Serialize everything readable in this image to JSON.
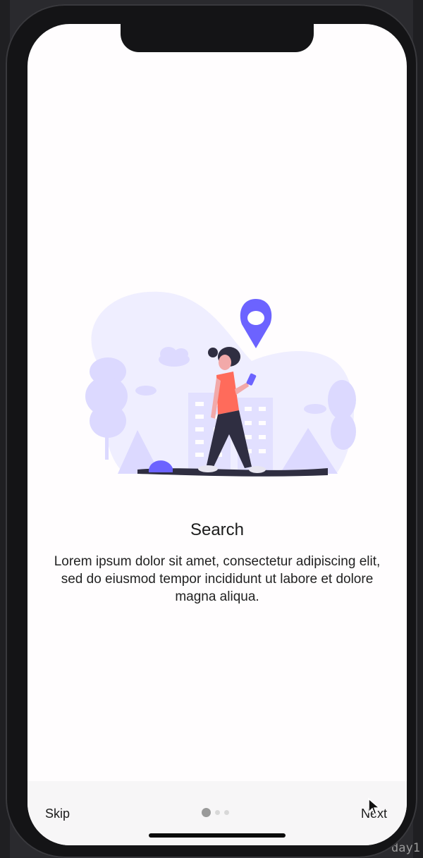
{
  "onboarding": {
    "title": "Search",
    "body": "Lorem ipsum dolor sit amet, consectetur adipiscing elit, sed do eiusmod tempor incididunt ut labore et dolore magna aliqua.",
    "illustration_icon": "location-pin-icon"
  },
  "bottom_bar": {
    "skip_label": "Skip",
    "next_label": "Next",
    "page_count": 3,
    "active_page": 1
  },
  "colors": {
    "accent": "#6c63ff",
    "shirt": "#ff6b5b",
    "background_blob": "#efeeff",
    "bottom_bar": "#f7f6f7"
  },
  "background_window": {
    "visible_text": "day1"
  }
}
